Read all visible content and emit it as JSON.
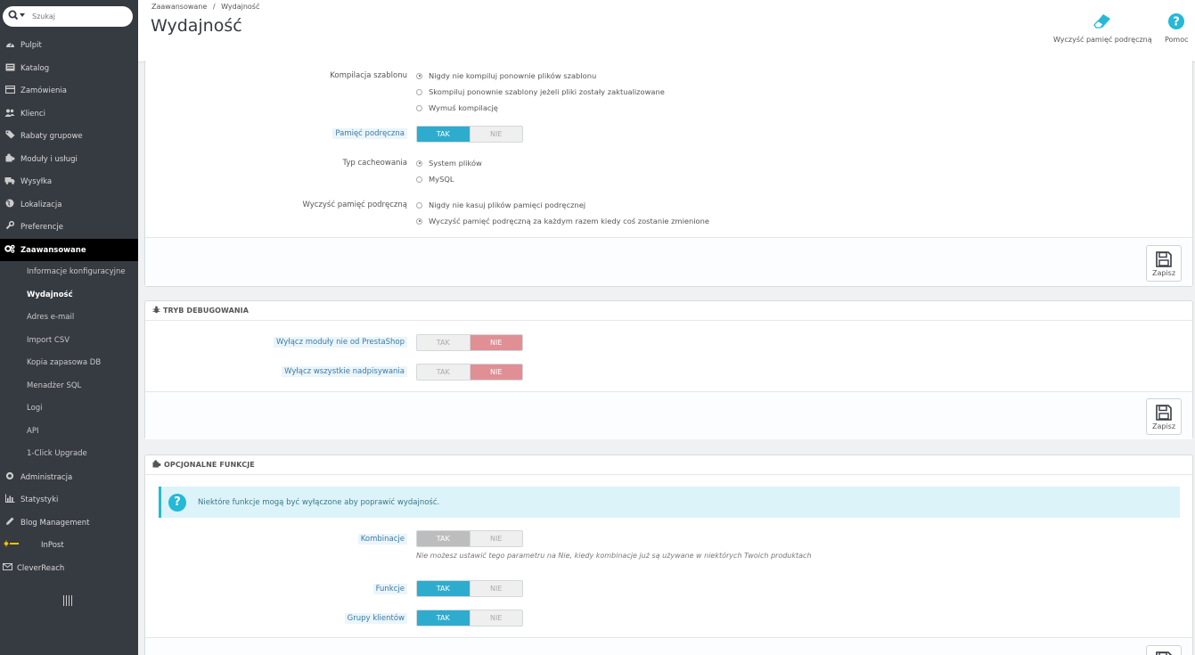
{
  "search": {
    "placeholder": "Szukaj"
  },
  "sidebar": {
    "items": [
      {
        "label": "Pulpit",
        "icon": "dashboard-icon"
      },
      {
        "label": "Katalog",
        "icon": "catalog-icon"
      },
      {
        "label": "Zamówienia",
        "icon": "orders-icon"
      },
      {
        "label": "Klienci",
        "icon": "customers-icon"
      },
      {
        "label": "Rabaty grupowe",
        "icon": "tag-icon"
      },
      {
        "label": "Moduły i usługi",
        "icon": "puzzle-icon"
      },
      {
        "label": "Wysyłka",
        "icon": "truck-icon"
      },
      {
        "label": "Lokalizacja",
        "icon": "globe-icon"
      },
      {
        "label": "Preferencje",
        "icon": "wrench-icon"
      },
      {
        "label": "Zaawansowane",
        "icon": "gears-icon"
      },
      {
        "label": "Administracja",
        "icon": "cog-icon"
      },
      {
        "label": "Statystyki",
        "icon": "bar-chart-icon"
      },
      {
        "label": "Blog Management",
        "icon": "pencil-icon"
      },
      {
        "label": "InPost",
        "icon": "inpost-icon"
      },
      {
        "label": "CleverReach",
        "icon": "envelope-icon"
      }
    ],
    "subitems": [
      "Informacje konfiguracyjne",
      "Wydajność",
      "Adres e-mail",
      "Import CSV",
      "Kopia zapasowa DB",
      "Menadżer SQL",
      "Logi",
      "API",
      "1-Click Upgrade"
    ]
  },
  "header": {
    "breadcrumb_parent": "Zaawansowane",
    "breadcrumb_sep": "/",
    "breadcrumb_current": "Wydajność",
    "title": "Wydajność",
    "clear_cache_label": "Wyczyść pamięć podręczną",
    "help_label": "Pomoc"
  },
  "smarty": {
    "compile_label": "Kompilacja szablonu",
    "compile_options": [
      "Nigdy nie kompiluj ponownie plików szablonu",
      "Skompiluj ponownie szablony jeżeli pliki zostały zaktualizowane",
      "Wymuś kompilację"
    ],
    "compile_selected": 0,
    "cache_label": "Pamięć podręczna",
    "cache_type_label": "Typ cacheowania",
    "cache_type_options": [
      "System plików",
      "MySQL"
    ],
    "cache_type_selected": 0,
    "clear_cache_label": "Wyczyść pamięć podręczną",
    "clear_cache_options": [
      "Nigdy nie kasuj plików pamięci podręcznej",
      "Wyczyść pamięć podręczną za każdym razem kiedy coś zostanie zmienione"
    ],
    "clear_cache_selected": 1
  },
  "switch": {
    "yes": "TAK",
    "no": "NIE"
  },
  "save_label": "Zapisz",
  "debug": {
    "heading": "TRYB DEBUGOWANIA",
    "disable_modules_label": "Wyłącz moduły nie od PrestaShop",
    "disable_overrides_label": "Wyłącz wszystkie nadpisywania"
  },
  "optional": {
    "heading": "OPCJONALNE FUNKCJE",
    "alert": "Niektóre funkcje mogą być wyłączone aby poprawić wydajność.",
    "combinations_label": "Kombinacje",
    "combinations_help": "Nie możesz ustawić tego parametru na Nie, kiedy kombinacje już są używane w niektórych Twoich produktach",
    "features_label": "Funkcje",
    "groups_label": "Grupy klientów"
  },
  "colors": {
    "sidebar": "#363a41",
    "active": "#000000",
    "primary": "#2eacce",
    "danger": "#e08f95",
    "info": "#25b9d7"
  }
}
